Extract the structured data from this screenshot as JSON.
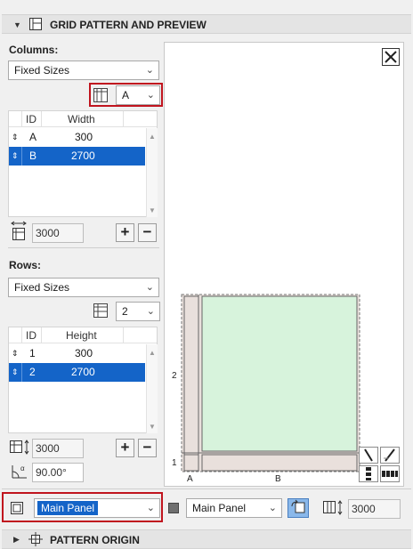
{
  "sections": {
    "grid_title": "GRID PATTERN AND PREVIEW",
    "origin_title": "PATTERN ORIGIN"
  },
  "columns": {
    "label": "Columns:",
    "mode": "Fixed Sizes",
    "pattern_select": "A",
    "table_headers": [
      "ID",
      "Width"
    ],
    "rows": [
      {
        "id": "A",
        "value": "300",
        "selected": false
      },
      {
        "id": "B",
        "value": "2700",
        "selected": true
      }
    ],
    "total": "3000"
  },
  "rows_section": {
    "label": "Rows:",
    "mode": "Fixed Sizes",
    "pattern_select": "2",
    "table_headers": [
      "ID",
      "Height"
    ],
    "rows": [
      {
        "id": "1",
        "value": "300",
        "selected": false
      },
      {
        "id": "2",
        "value": "2700",
        "selected": true
      }
    ],
    "total": "3000",
    "angle": "90.00°"
  },
  "preview": {
    "col_labels": [
      "A",
      "B"
    ],
    "row_labels": [
      "1",
      "2"
    ],
    "colors": {
      "cell_fill": "#d7f3dc",
      "frame_fill": "#e9e0dc"
    }
  },
  "bottom": {
    "panel_select": "Main Panel",
    "panel_select_2": "Main Panel",
    "size_value": "3000"
  },
  "icons": [
    "close-icon",
    "add-icon",
    "remove-icon",
    "grid-icon",
    "panel-icon",
    "reorder-icon",
    "width-icon",
    "height-icon",
    "angle-icon",
    "link-icon"
  ]
}
